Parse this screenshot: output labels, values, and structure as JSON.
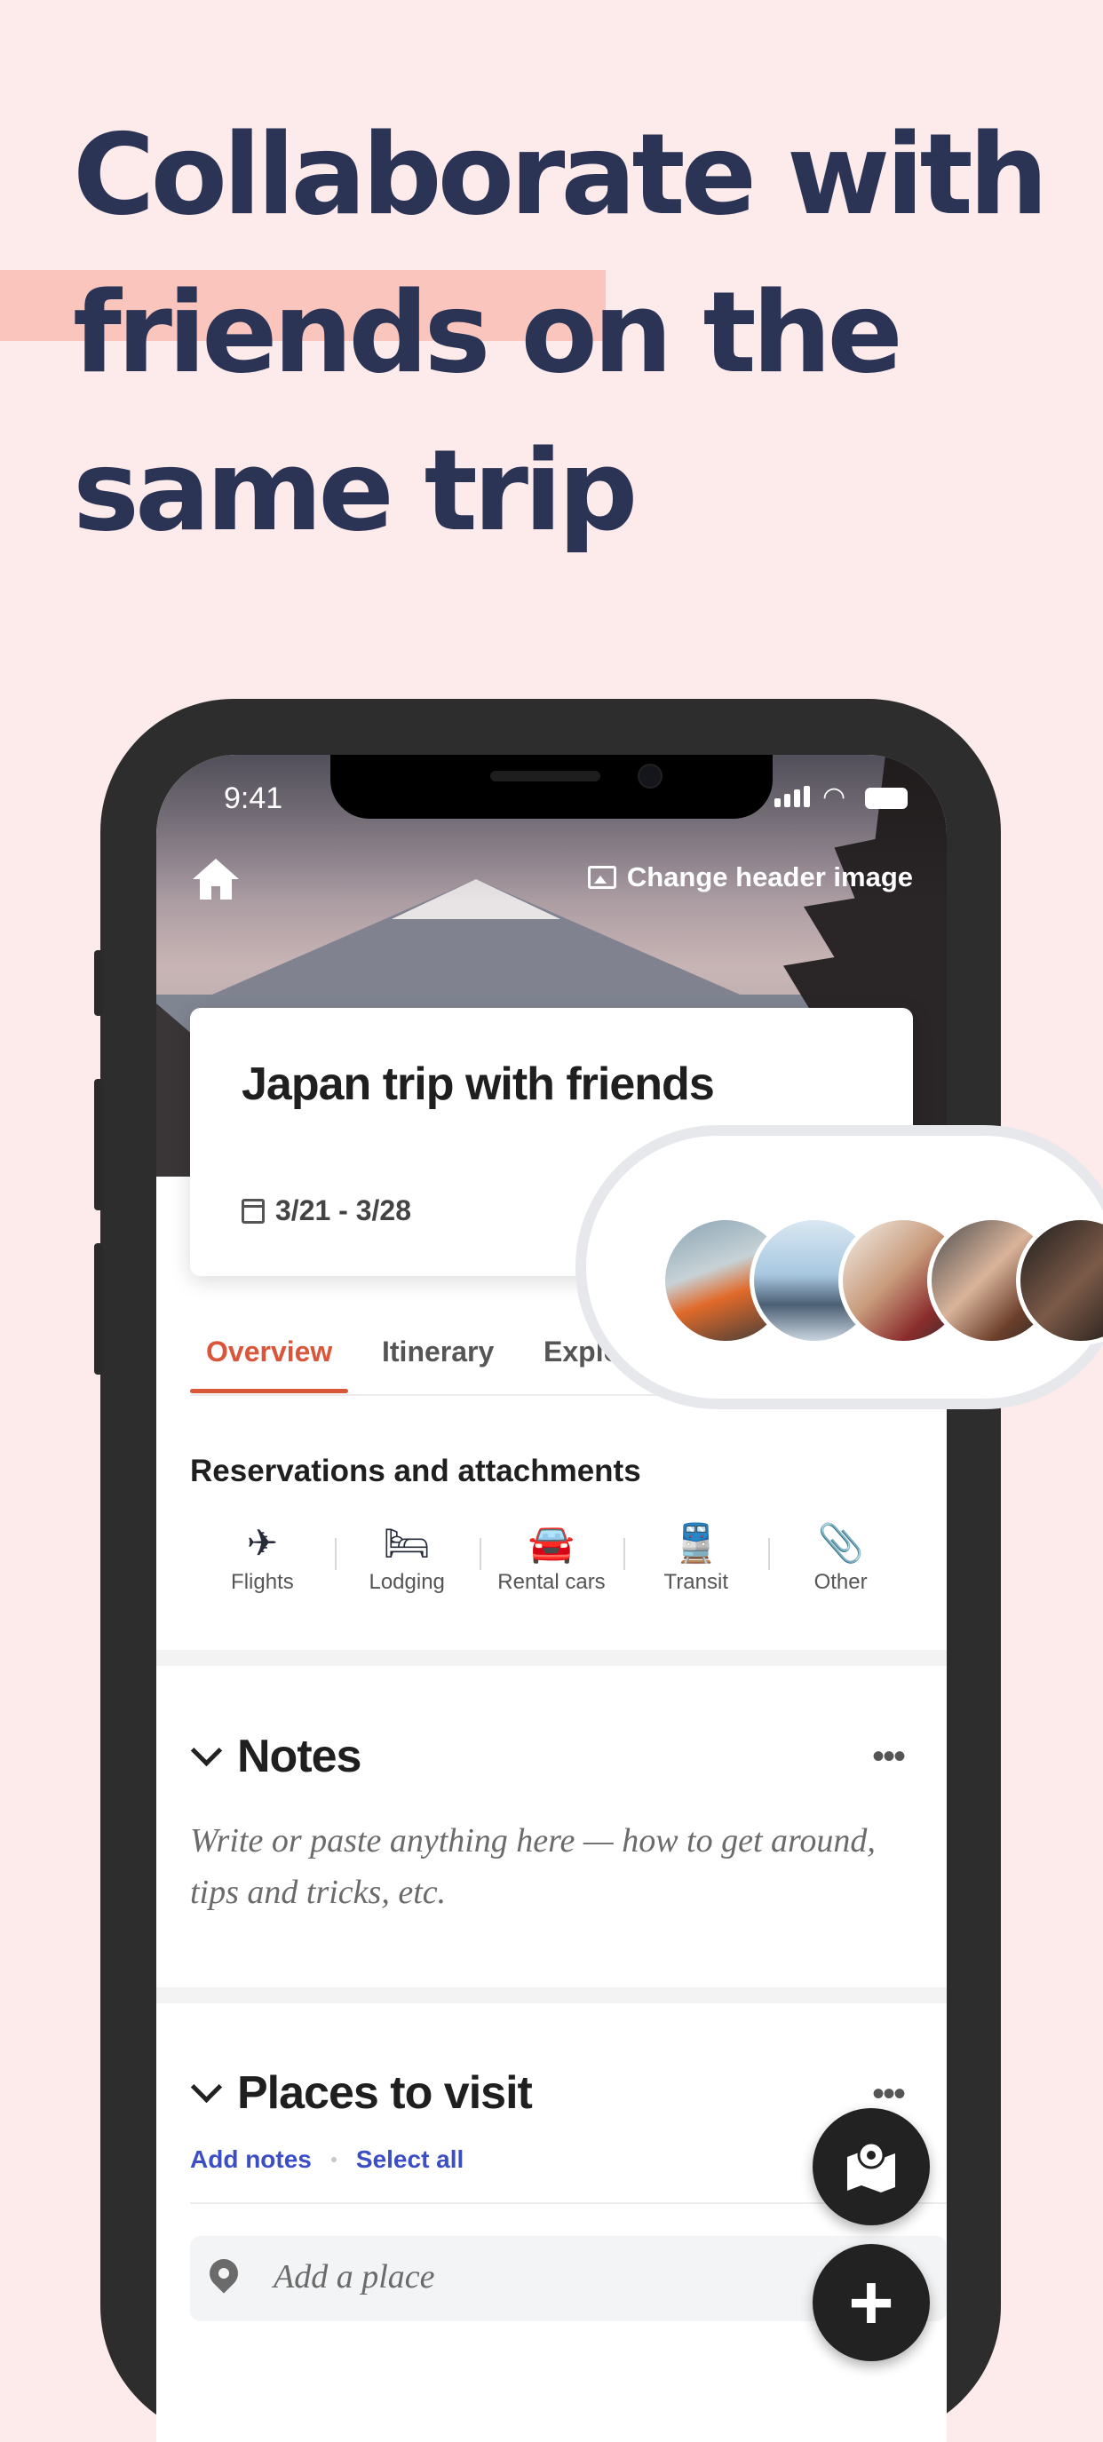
{
  "headline": {
    "lines": [
      "Collaborate with",
      "friends on the",
      "same trip"
    ]
  },
  "status_bar": {
    "time": "9:41"
  },
  "header": {
    "change_image_label": "Change header image"
  },
  "trip": {
    "title": "Japan trip with friends",
    "dates": "3/21 - 3/28"
  },
  "tabs": [
    {
      "label": "Overview",
      "active": true
    },
    {
      "label": "Itinerary",
      "active": false
    },
    {
      "label": "Explo",
      "active": false
    }
  ],
  "reservations": {
    "title": "Reservations and attachments",
    "items": [
      {
        "label": "Flights",
        "icon": "airplane-icon",
        "glyph": "✈"
      },
      {
        "label": "Lodging",
        "icon": "bed-icon",
        "glyph": "🛏"
      },
      {
        "label": "Rental cars",
        "icon": "car-icon",
        "glyph": "🚘"
      },
      {
        "label": "Transit",
        "icon": "train-icon",
        "glyph": "🚆"
      },
      {
        "label": "Other",
        "icon": "paperclip-icon",
        "glyph": "📎"
      }
    ]
  },
  "notes": {
    "title": "Notes",
    "more": "•••",
    "placeholder": "Write or paste anything here — how to get around, tips and tricks, etc."
  },
  "places": {
    "title": "Places to visit",
    "more": "•••",
    "add_notes": "Add notes",
    "select_all": "Select all",
    "add_place_placeholder": "Add a place"
  },
  "fab": {
    "add_glyph": "+"
  },
  "colors": {
    "background": "#fdeaea",
    "headline": "#2c3456",
    "highlight": "#f9c5bd",
    "accent": "#d9563b",
    "link": "#3b4ec5"
  }
}
